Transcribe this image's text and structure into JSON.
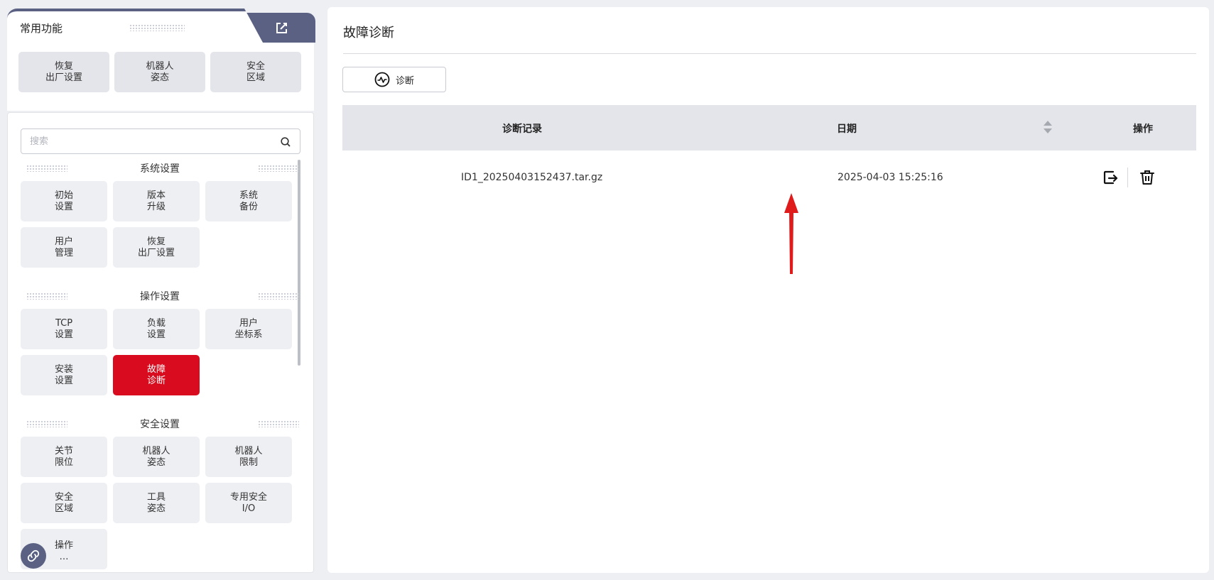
{
  "favorites": {
    "title": "常用功能",
    "buttons": [
      "恢复\n出厂设置",
      "机器人\n姿态",
      "安全\n区域"
    ]
  },
  "search": {
    "placeholder": "搜索"
  },
  "sections": [
    {
      "title": "系统设置",
      "items": [
        {
          "label": "初始\n设置"
        },
        {
          "label": "版本\n升级"
        },
        {
          "label": "系统\n备份"
        },
        {
          "label": "用户\n管理"
        },
        {
          "label": "恢复\n出厂设置"
        }
      ]
    },
    {
      "title": "操作设置",
      "items": [
        {
          "label": "TCP\n设置"
        },
        {
          "label": "负载\n设置"
        },
        {
          "label": "用户\n坐标系"
        },
        {
          "label": "安装\n设置"
        },
        {
          "label": "故障\n诊断",
          "active": true
        }
      ]
    },
    {
      "title": "安全设置",
      "items": [
        {
          "label": "关节\n限位"
        },
        {
          "label": "机器人\n姿态"
        },
        {
          "label": "机器人\n限制"
        },
        {
          "label": "安全\n区域"
        },
        {
          "label": "工具\n姿态"
        },
        {
          "label": "专用安全\nI/O"
        },
        {
          "label": "操作\n…"
        }
      ]
    }
  ],
  "main": {
    "title": "故障诊断",
    "diagnose_button": "诊断",
    "columns": [
      "诊断记录",
      "日期",
      "操作"
    ],
    "rows": [
      {
        "record": "ID1_20250403152437.tar.gz",
        "date": "2025-04-03 15:25:16"
      }
    ]
  },
  "colors": {
    "accent": "#5a6183",
    "active": "#d80c1e",
    "arrow": "#e01b1b"
  }
}
